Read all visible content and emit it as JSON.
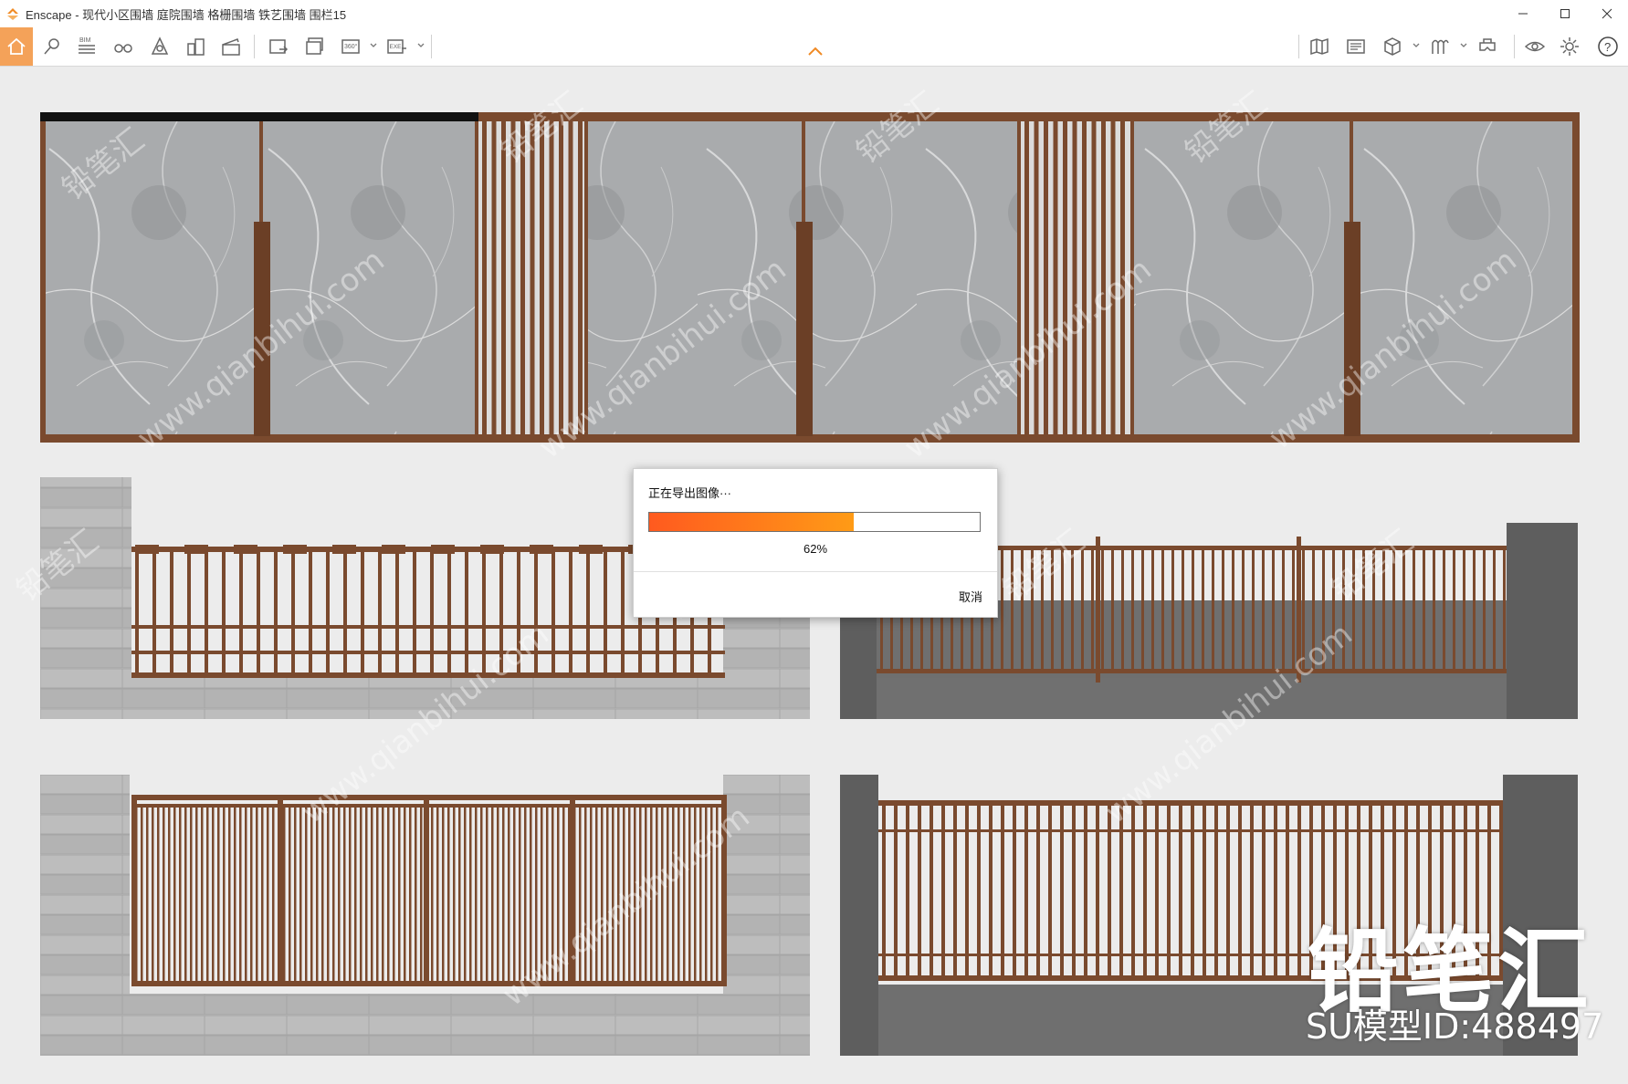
{
  "window": {
    "app_name": "Enscape",
    "title": "Enscape - 现代小区围墙 庭院围墙 格栅围墙 铁艺围墙 围栏15"
  },
  "toolbar": {
    "left_tools": [
      {
        "name": "home-icon",
        "active": true
      },
      {
        "name": "pin-icon"
      },
      {
        "name": "bim-icon",
        "label": "BIM"
      },
      {
        "name": "binoculars-icon"
      },
      {
        "name": "sun-icon"
      },
      {
        "name": "buildings-icon"
      },
      {
        "name": "clapper-icon"
      },
      {
        "name": "screenshot-export-icon"
      },
      {
        "name": "batch-export-icon"
      },
      {
        "name": "panorama-360-icon",
        "label": "360°"
      },
      {
        "name": "exe-export-icon",
        "label": "EXE"
      }
    ],
    "right_tools": [
      {
        "name": "map-icon"
      },
      {
        "name": "capture-icon"
      },
      {
        "name": "cube-icon"
      },
      {
        "name": "materials-icon"
      },
      {
        "name": "vr-headset-icon"
      },
      {
        "name": "view-icon"
      },
      {
        "name": "settings-gear-icon"
      },
      {
        "name": "help-icon",
        "label": "?"
      }
    ]
  },
  "dialog": {
    "title": "正在导出图像···",
    "progress_percent": 62,
    "progress_label": "62%",
    "cancel_label": "取消"
  },
  "watermark": {
    "brand": "铅笔汇",
    "model_id": "SU模型ID:488497",
    "diagonal_text": "www.qianbihui.com",
    "diagonal_brand": "铅笔汇"
  },
  "colors": {
    "accent": "#f4a259",
    "bronze": "#7a4a2e",
    "marble": "#a9abad",
    "concrete_light": "#b9b9b9",
    "concrete_dark": "#6f6f6f",
    "progress_start": "#ff5a1f",
    "progress_end": "#ff9b16"
  }
}
